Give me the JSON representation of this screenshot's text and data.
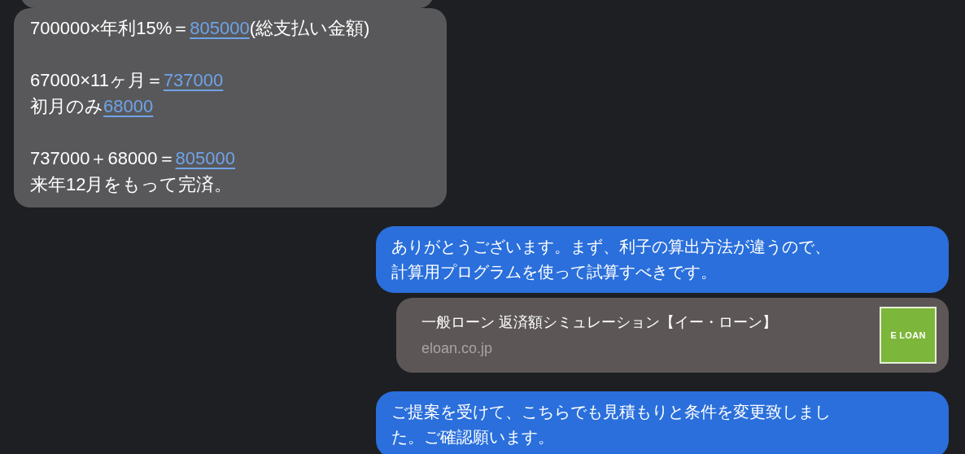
{
  "messages": [
    {
      "kind": "partial"
    },
    {
      "kind": "received",
      "paragraphs": [
        [
          [
            {
              "kind": "text",
              "text": "700000×年利15%＝"
            },
            {
              "kind": "link",
              "text": "805000"
            },
            {
              "kind": "text",
              "text": "(総支払い金額)"
            }
          ]
        ],
        [
          [
            {
              "kind": "text",
              "text": "67000×11ヶ月＝"
            },
            {
              "kind": "link",
              "text": "737000"
            }
          ],
          [
            {
              "kind": "text",
              "text": "初月のみ"
            },
            {
              "kind": "link",
              "text": "68000"
            }
          ]
        ],
        [
          [
            {
              "kind": "text",
              "text": "737000＋68000＝"
            },
            {
              "kind": "link",
              "text": "805000"
            }
          ],
          [
            {
              "kind": "text",
              "text": "来年12月をもって完済。"
            }
          ]
        ]
      ]
    },
    {
      "kind": "sent",
      "lines": [
        "ありがとうございます。まず、利子の算出方法が違うので、",
        "計算用プログラムを使って試算すべきです。"
      ]
    },
    {
      "kind": "link_preview",
      "title": "一般ローン 返済額シミュレーション【イー・ローン】",
      "domain": "eloan.co.jp",
      "logo": "E LOAN"
    },
    {
      "kind": "sent",
      "lines": [
        "ご提案を受けて、こちらでも見積もりと条件を変更致しまし",
        "た。ご確認願います。"
      ]
    }
  ]
}
